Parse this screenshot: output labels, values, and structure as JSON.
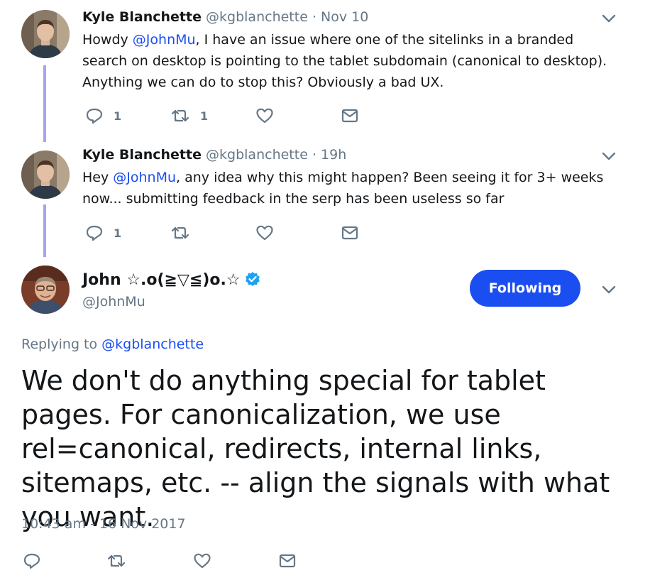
{
  "tweets": [
    {
      "name": "Kyle Blanchette",
      "handle": "@kgblanchette",
      "separator": "·",
      "time": "Nov 10",
      "text_prefix": "Howdy ",
      "mention": "@JohnMu",
      "text_suffix": ", I have an issue where one of the sitelinks in a branded search on desktop is pointing to the tablet subdomain (canonical to desktop). Anything we can do to stop this? Obviously a bad UX.",
      "reply_count": "1",
      "retweet_count": "1"
    },
    {
      "name": "Kyle Blanchette",
      "handle": "@kgblanchette",
      "separator": "·",
      "time": "19h",
      "text_prefix": "Hey ",
      "mention": "@JohnMu",
      "text_suffix": ", any idea why this might happen? Been seeing it for 3+ weeks now... submitting feedback in the serp has been useless so far",
      "reply_count": "1",
      "retweet_count": ""
    }
  ],
  "main_tweet": {
    "name": "John ☆.o(≧▽≦)o.☆",
    "handle": "@JohnMu",
    "follow_label": "Following",
    "replying_prefix": "Replying to ",
    "replying_to": "@kgblanchette",
    "text": "We don't do anything special for tablet pages. For canonicalization, we use rel=canonical, redirects, internal links, sitemaps, etc. -- align the signals with what you want.",
    "timestamp": "10:43 am - 16 Nov 2017"
  },
  "icons": {
    "reply": "reply-icon",
    "retweet": "retweet-icon",
    "like": "heart-icon",
    "dm": "envelope-icon",
    "more": "chevron-down-icon",
    "verified": "verified-badge-icon"
  },
  "colors": {
    "accent": "#1b4ef0",
    "muted": "#657786",
    "thread": "#a7a3ef",
    "text": "#14171a"
  }
}
